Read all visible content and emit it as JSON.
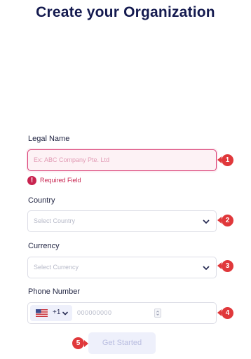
{
  "page": {
    "title": "Create your Organization"
  },
  "form": {
    "legal_name": {
      "label": "Legal Name",
      "placeholder": "Ex: ABC Company Pte. Ltd",
      "error": "Required Field"
    },
    "country": {
      "label": "Country",
      "placeholder": "Select Country"
    },
    "currency": {
      "label": "Currency",
      "placeholder": "Select Currency"
    },
    "phone": {
      "label": "Phone Number",
      "country_code": "+1",
      "placeholder": "000000000"
    },
    "submit_label": "Get Started"
  },
  "markers": [
    "1",
    "2",
    "3",
    "4",
    "5"
  ],
  "colors": {
    "title": "#141a4f",
    "error": "#c8234f",
    "marker": "#e0383b",
    "button_bg": "#eef0fb"
  }
}
